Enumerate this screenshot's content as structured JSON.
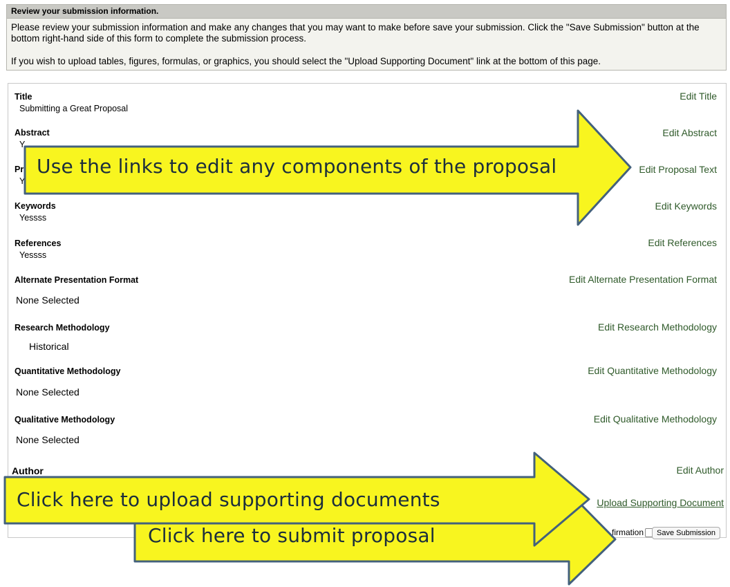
{
  "intro": {
    "header": "Review your submission information.",
    "paragraph1": "Please review your submission information and make any changes that you may want to make before save your submission. Click the \"Save Submission\" button at the bottom right-hand side of this form to complete the submission process.",
    "paragraph2": "If you wish to upload tables, figures, formulas, or graphics, you should select the \"Upload Supporting Document\" link at the bottom of this page."
  },
  "fields": {
    "title": {
      "label": "Title",
      "value": "Submitting a Great Proposal",
      "link": "Edit Title"
    },
    "abstract": {
      "label": "Abstract",
      "value": "Y",
      "link": "Edit Abstract"
    },
    "proposal_text": {
      "label": "Pr",
      "value": "Y",
      "link": "Edit Proposal Text"
    },
    "keywords": {
      "label": "Keywords",
      "value": "Yessss",
      "link": "Edit Keywords"
    },
    "references": {
      "label": "References",
      "value": "Yessss",
      "link": "Edit References"
    },
    "alternate_format": {
      "label": "Alternate Presentation Format",
      "value": "None Selected",
      "link": "Edit Alternate Presentation Format"
    },
    "research_methodology": {
      "label": "Research Methodology",
      "value": "Historical",
      "link": "Edit Research Methodology"
    },
    "quantitative_methodology": {
      "label": "Quantitative Methodology",
      "value": "None Selected",
      "link": "Edit Quantitative Methodology"
    },
    "qualitative_methodology": {
      "label": "Qualitative Methodology",
      "value": "None Selected",
      "link": "Edit Qualitative Methodology"
    },
    "author": {
      "label": "Author",
      "link": "Edit Author"
    }
  },
  "upload_link": "Upload Supporting Document",
  "confirmation_label": "firmation",
  "save_button": "Save Submission",
  "callouts": {
    "edit_links": "Use the links to edit any components of the proposal",
    "upload": "Click here to upload supporting documents",
    "submit": "Click here to submit proposal"
  },
  "colors": {
    "arrow_fill": "#f8f51f",
    "arrow_stroke": "#43617c",
    "link": "#2f5a2a"
  }
}
